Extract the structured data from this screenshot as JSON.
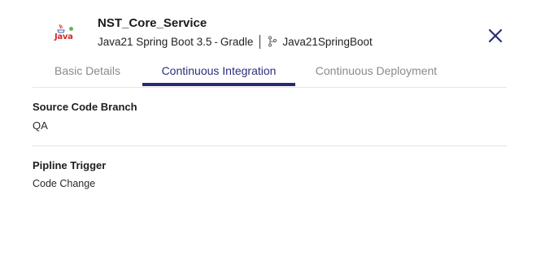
{
  "service": {
    "name": "NST_Core_Service",
    "stack": "Java21 Spring Boot 3.5",
    "build_tool": "Gradle",
    "repo": "Java21SpringBoot",
    "logo_text": "Java",
    "status_color": "#5cb85c"
  },
  "tabs": [
    {
      "label": "Basic Details",
      "active": false
    },
    {
      "label": "Continuous Integration",
      "active": true
    },
    {
      "label": "Continuous Deployment",
      "active": false
    }
  ],
  "fields": {
    "source_branch": {
      "label": "Source Code Branch",
      "value": "QA"
    },
    "pipeline_trigger": {
      "label": "Pipline Trigger",
      "value": "Code Change"
    }
  },
  "colors": {
    "accent": "#262a76",
    "close_icon": "#2b2f7a"
  }
}
